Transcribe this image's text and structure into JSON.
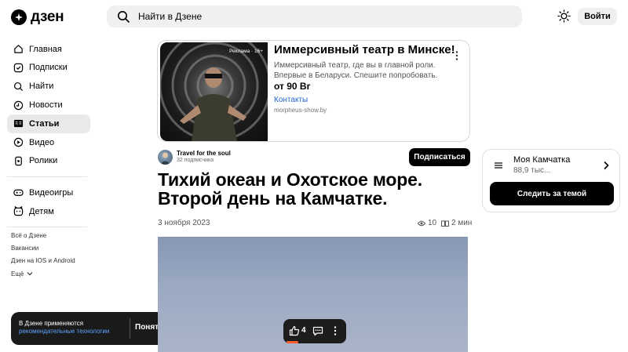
{
  "header": {
    "logo_text": "дзен",
    "search_placeholder": "Найти в Дзене",
    "login_label": "Войти"
  },
  "sidebar": {
    "items": [
      {
        "label": "Главная",
        "icon": "home-icon"
      },
      {
        "label": "Подписки",
        "icon": "subscriptions-icon"
      },
      {
        "label": "Найти",
        "icon": "search-icon"
      },
      {
        "label": "Новости",
        "icon": "news-icon"
      },
      {
        "label": "Статьи",
        "icon": "articles-icon",
        "active": true
      },
      {
        "label": "Видео",
        "icon": "video-icon"
      },
      {
        "label": "Ролики",
        "icon": "shorts-icon"
      },
      {
        "label": "Видеоигры",
        "icon": "gamepad-icon"
      },
      {
        "label": "Детям",
        "icon": "kids-icon"
      }
    ],
    "footer_links": [
      "Всё о Дзене",
      "Вакансии",
      "Дзен на IOS и Android",
      "Ещё"
    ]
  },
  "cookie_toast": {
    "text": "В Дзене применяются",
    "link": "рекомендательные технологии",
    "button": "Понятно"
  },
  "ad": {
    "badge": "Реклама · 16+",
    "title": "Иммерсивный театр в Минске!",
    "description": "Иммерсивный театр, где вы в главной роли. Впервые в Беларуси. Спешите попробовать.",
    "price": "от 90 Br",
    "link_label": "Контакты",
    "domain": "morpheus-show.by"
  },
  "author": {
    "name": "Travel for the soul",
    "subscribers": "32 подписчика",
    "subscribe_label": "Подписаться"
  },
  "article": {
    "title": "Тихий океан и Охотское море. Второй день на Камчатке.",
    "date": "3 ноября 2023",
    "views": "10",
    "read_time": "2 мин"
  },
  "actions": {
    "likes": "4"
  },
  "topic_card": {
    "name": "Моя Камчатка",
    "count": "88,9 тыс...",
    "button": "Следить за темой"
  },
  "colors": {
    "accent_orange": "#ff5b2e",
    "link_blue": "#2266cc"
  }
}
